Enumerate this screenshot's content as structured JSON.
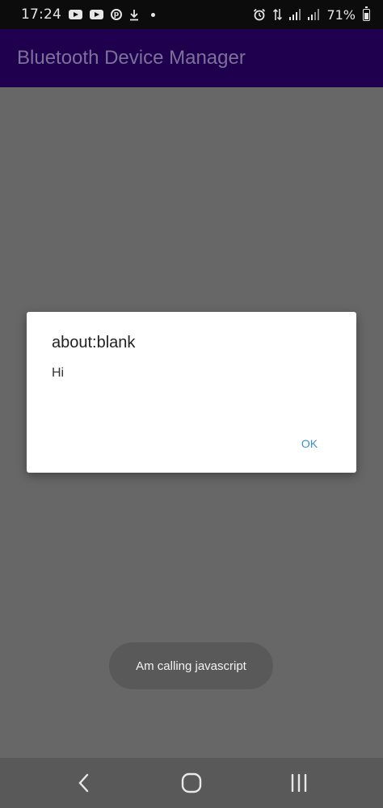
{
  "status_bar": {
    "time": "17:24",
    "battery": "71%",
    "left_icons": [
      "youtube-icon",
      "youtube-icon",
      "pinterest-icon",
      "download-icon",
      "dot-icon"
    ],
    "right_icons": [
      "alarm-icon",
      "data-transfer-icon",
      "signal-icon",
      "signal-icon",
      "battery-icon"
    ]
  },
  "app_bar": {
    "title": "Bluetooth Device Manager",
    "background": "#1f004f"
  },
  "dialog": {
    "title": "about:blank",
    "message": "Hi",
    "ok_label": "OK",
    "accent": "#3b8fc4"
  },
  "toast": {
    "text": "Am calling javascript"
  },
  "nav_bar": {
    "buttons": [
      "back-icon",
      "home-icon",
      "recents-icon"
    ]
  }
}
